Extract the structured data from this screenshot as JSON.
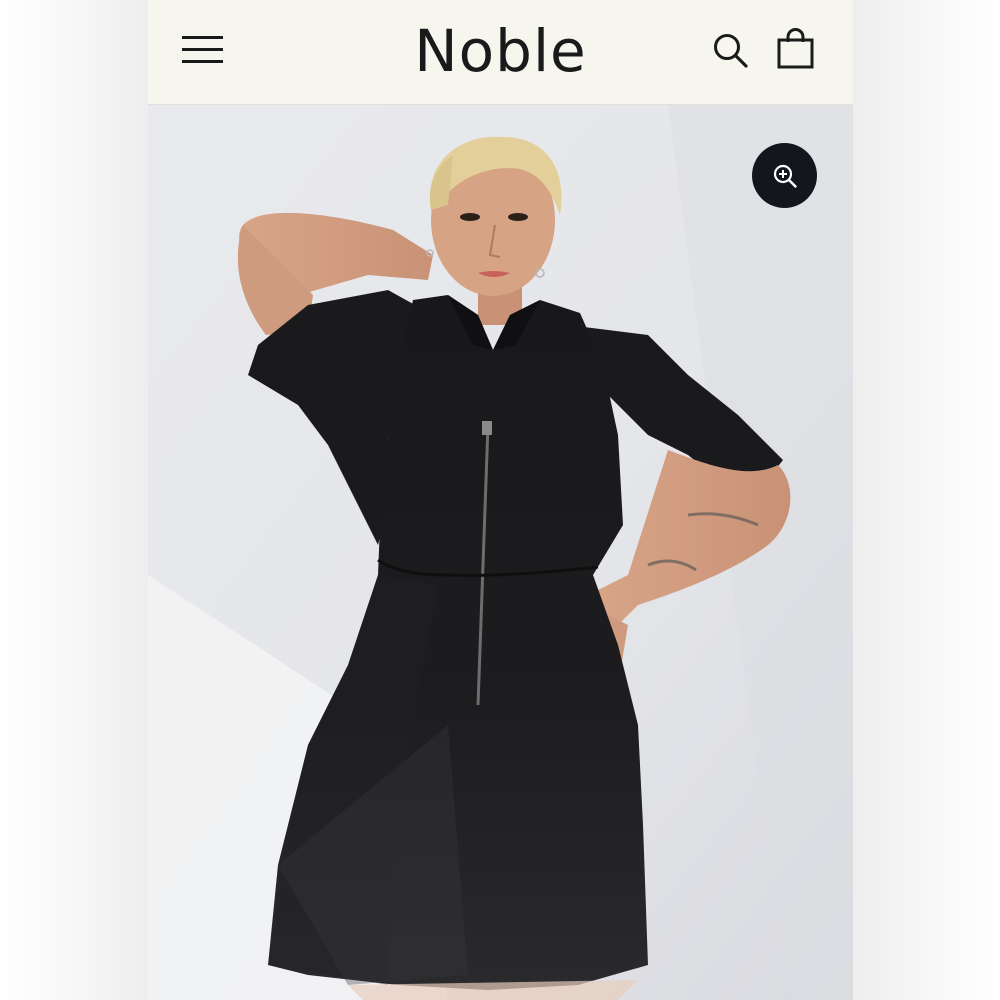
{
  "header": {
    "brand": "Noble",
    "menu_icon": "hamburger-menu-icon",
    "search_icon": "search-icon",
    "bag_icon": "shopping-bag-icon"
  },
  "product_image": {
    "zoom_icon": "zoom-in-icon"
  },
  "colors": {
    "header_background": "#f7f6ee",
    "icon_color": "#1a1a1a",
    "zoom_button_background": "#14161d",
    "dress_color": "#1b1b1d"
  }
}
